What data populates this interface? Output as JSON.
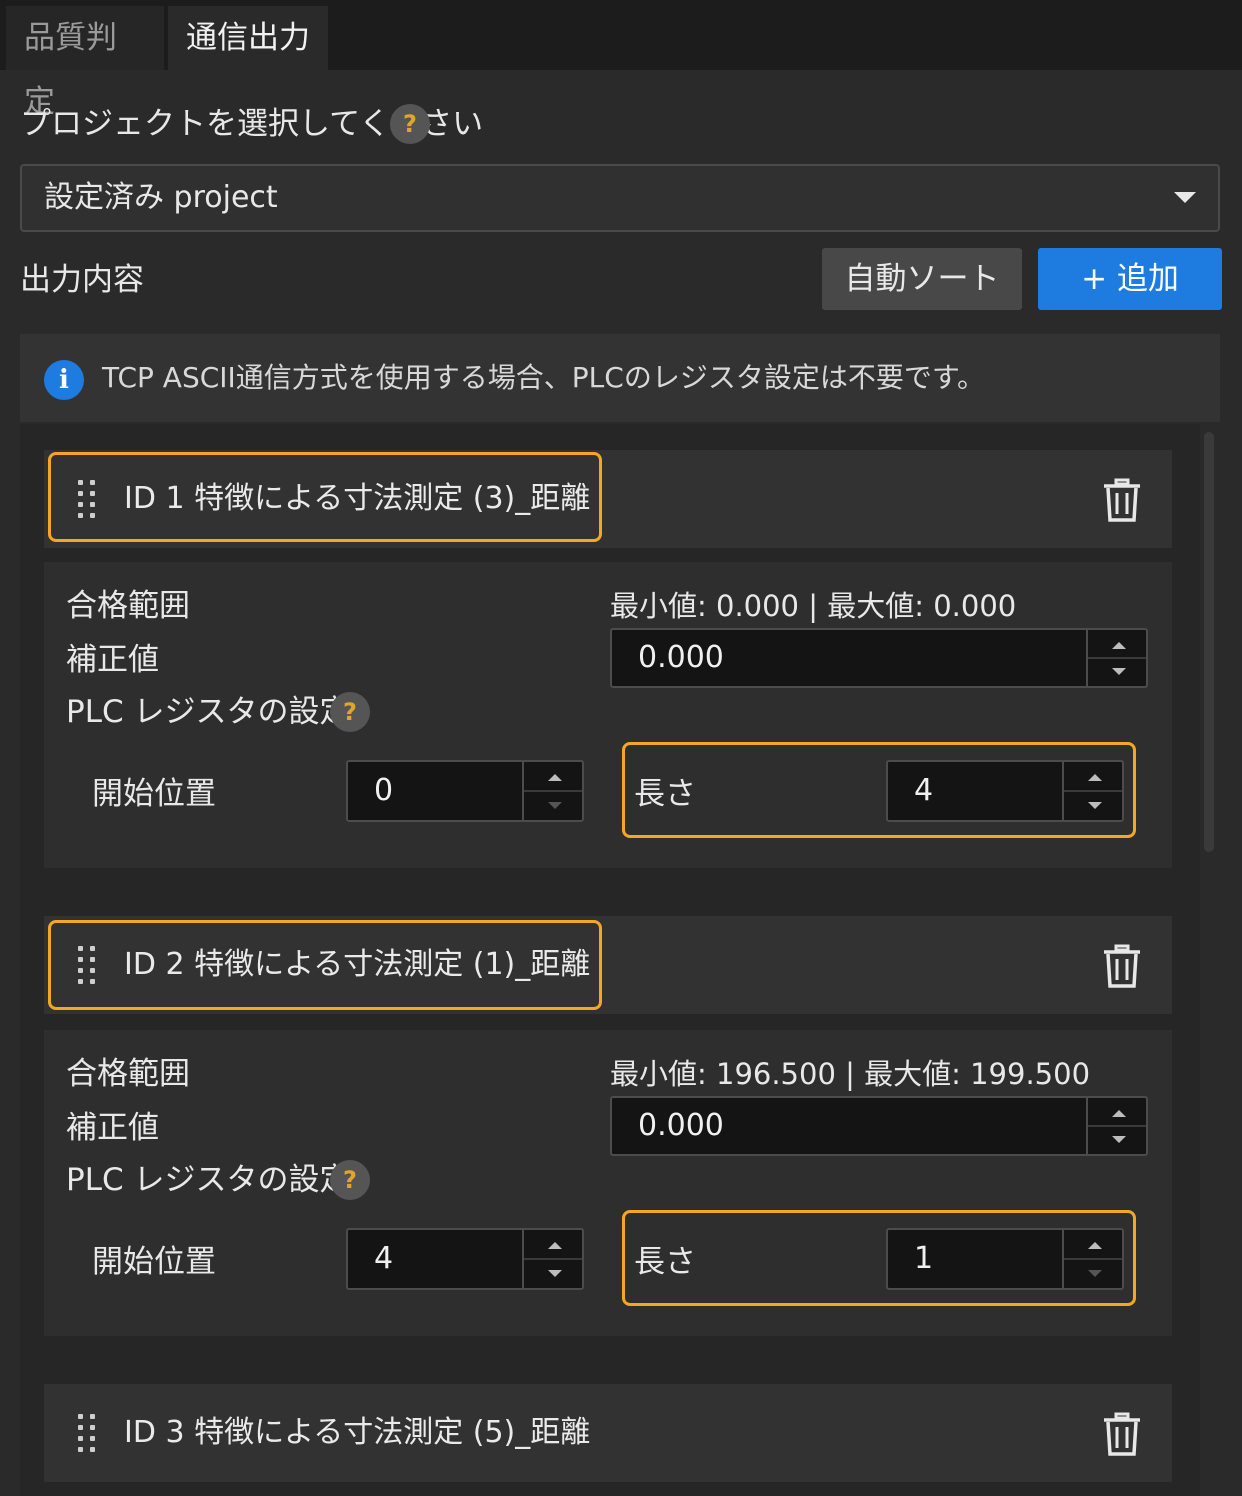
{
  "tabs": [
    {
      "label": "品質判定"
    },
    {
      "label": "通信出力"
    }
  ],
  "project": {
    "label": "プロジェクトを選択してください",
    "help": "?",
    "selected": "設定済み project"
  },
  "output": {
    "label": "出力内容",
    "sort_label": "自動ソート",
    "add_label": "+ 追加"
  },
  "info": {
    "icon": "i",
    "text": "TCP ASCII通信方式を使用する場合、PLCのレジスタ設定は不要です。"
  },
  "items": [
    {
      "title": "ID 1  特徴による寸法測定 (3)_距離",
      "range_label": "合格範囲",
      "range_value": "最小値: 0.000 | 最大値: 0.000",
      "correction_label": "補正値",
      "correction_value": "0.000",
      "plc_label": "PLC レジスタの設定",
      "help": "?",
      "start_label": "開始位置",
      "start_value": "0",
      "length_label": "長さ",
      "length_value": "4"
    },
    {
      "title": "ID 2  特徴による寸法測定 (1)_距離",
      "range_label": "合格範囲",
      "range_value": "最小値: 196.500 | 最大値: 199.500",
      "correction_label": "補正値",
      "correction_value": "0.000",
      "plc_label": "PLC レジスタの設定",
      "help": "?",
      "start_label": "開始位置",
      "start_value": "4",
      "length_label": "長さ",
      "length_value": "1"
    },
    {
      "title": "ID 3  特徴による寸法測定 (5)_距離"
    }
  ],
  "colors": {
    "accent": "#1e7be0",
    "highlight": "#f5a623",
    "background": "#2a2a2a"
  }
}
